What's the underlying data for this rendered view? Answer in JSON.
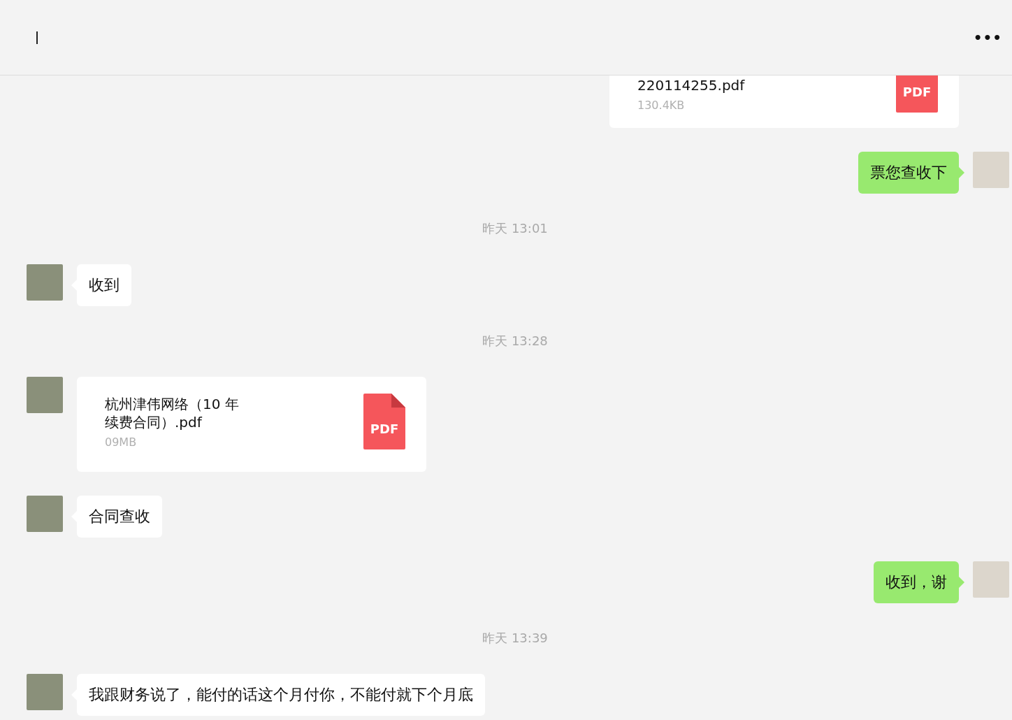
{
  "header": {
    "more": "•••"
  },
  "messages": [
    {
      "kind": "file",
      "outgoing": true,
      "name_lines": [
        "220114255.pdf"
      ],
      "size": "130.4KB",
      "badge": "PDF"
    },
    {
      "kind": "text",
      "outgoing": true,
      "text": "票您查收下"
    },
    {
      "kind": "time",
      "text": "昨天 13:01"
    },
    {
      "kind": "text",
      "outgoing": false,
      "text": "收到"
    },
    {
      "kind": "time",
      "text": "昨天 13:28"
    },
    {
      "kind": "file",
      "outgoing": false,
      "name_lines": [
        "杭州津伟网络（10 年",
        "续费合同）.pdf"
      ],
      "size": "09MB",
      "badge": "PDF"
    },
    {
      "kind": "text",
      "outgoing": false,
      "text": "合同查收"
    },
    {
      "kind": "text",
      "outgoing": true,
      "text": "收到，谢"
    },
    {
      "kind": "time",
      "text": "昨天 13:39"
    },
    {
      "kind": "text",
      "outgoing": false,
      "text": "我跟财务说了，能付的话这个月付你，不能付就下个月底"
    }
  ]
}
